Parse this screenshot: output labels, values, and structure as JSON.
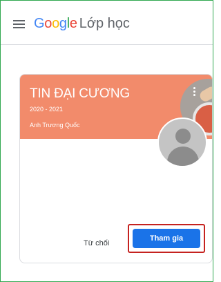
{
  "header": {
    "brand_letters": [
      "G",
      "o",
      "o",
      "g",
      "l",
      "e"
    ],
    "product": "Lớp học"
  },
  "class_card": {
    "title": "TIN ĐẠI CƯƠNG",
    "year": "2020 - 2021",
    "teacher": "Anh Trương Quốc",
    "banner_color": "#f28b6b",
    "decline_label": "Từ chối",
    "join_label": "Tham gia"
  },
  "colors": {
    "join_button": "#1a73e8",
    "highlight_box": "#c5221f",
    "frame_border": "#2fa84f"
  }
}
